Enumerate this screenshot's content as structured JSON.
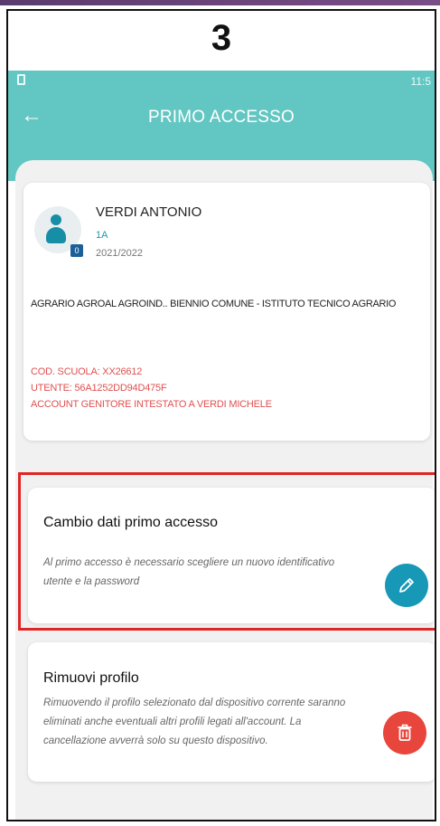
{
  "step": {
    "number": "3"
  },
  "statusbar": {
    "time": "11:5"
  },
  "appbar": {
    "back_icon": "arrow-left-icon",
    "title": "PRIMO ACCESSO"
  },
  "profile": {
    "name": "VERDI ANTONIO",
    "class": "1A",
    "year": "2021/2022",
    "badge": "0",
    "school": "AGRARIO AGROAL AGROIND.. BIENNIO COMUNE - ISTITUTO TECNICO AGRARIO",
    "cod_scuola": "COD. SCUOLA: XX26612",
    "utente": "UTENTE: 56A1252DD94D475F",
    "account": "ACCOUNT GENITORE INTESTATO A VERDI MICHELE"
  },
  "change_card": {
    "title": "Cambio dati primo accesso",
    "description": "Al primo accesso è necessario scegliere un nuovo identificativo utente e la password",
    "action_icon": "pencil-icon"
  },
  "remove_card": {
    "title": "Rimuovi profilo",
    "description": "Rimuovendo il profilo selezionato dal dispositivo corrente saranno eliminati anche eventuali altri profili legati all'account. La cancellazione avverrà solo su questo dispositivo.",
    "action_icon": "trash-icon"
  },
  "colors": {
    "teal": "#62c6c2",
    "fab_blue": "#1798b6",
    "fab_red": "#e8453c",
    "highlight": "#e02525",
    "info_red": "#e05050"
  }
}
